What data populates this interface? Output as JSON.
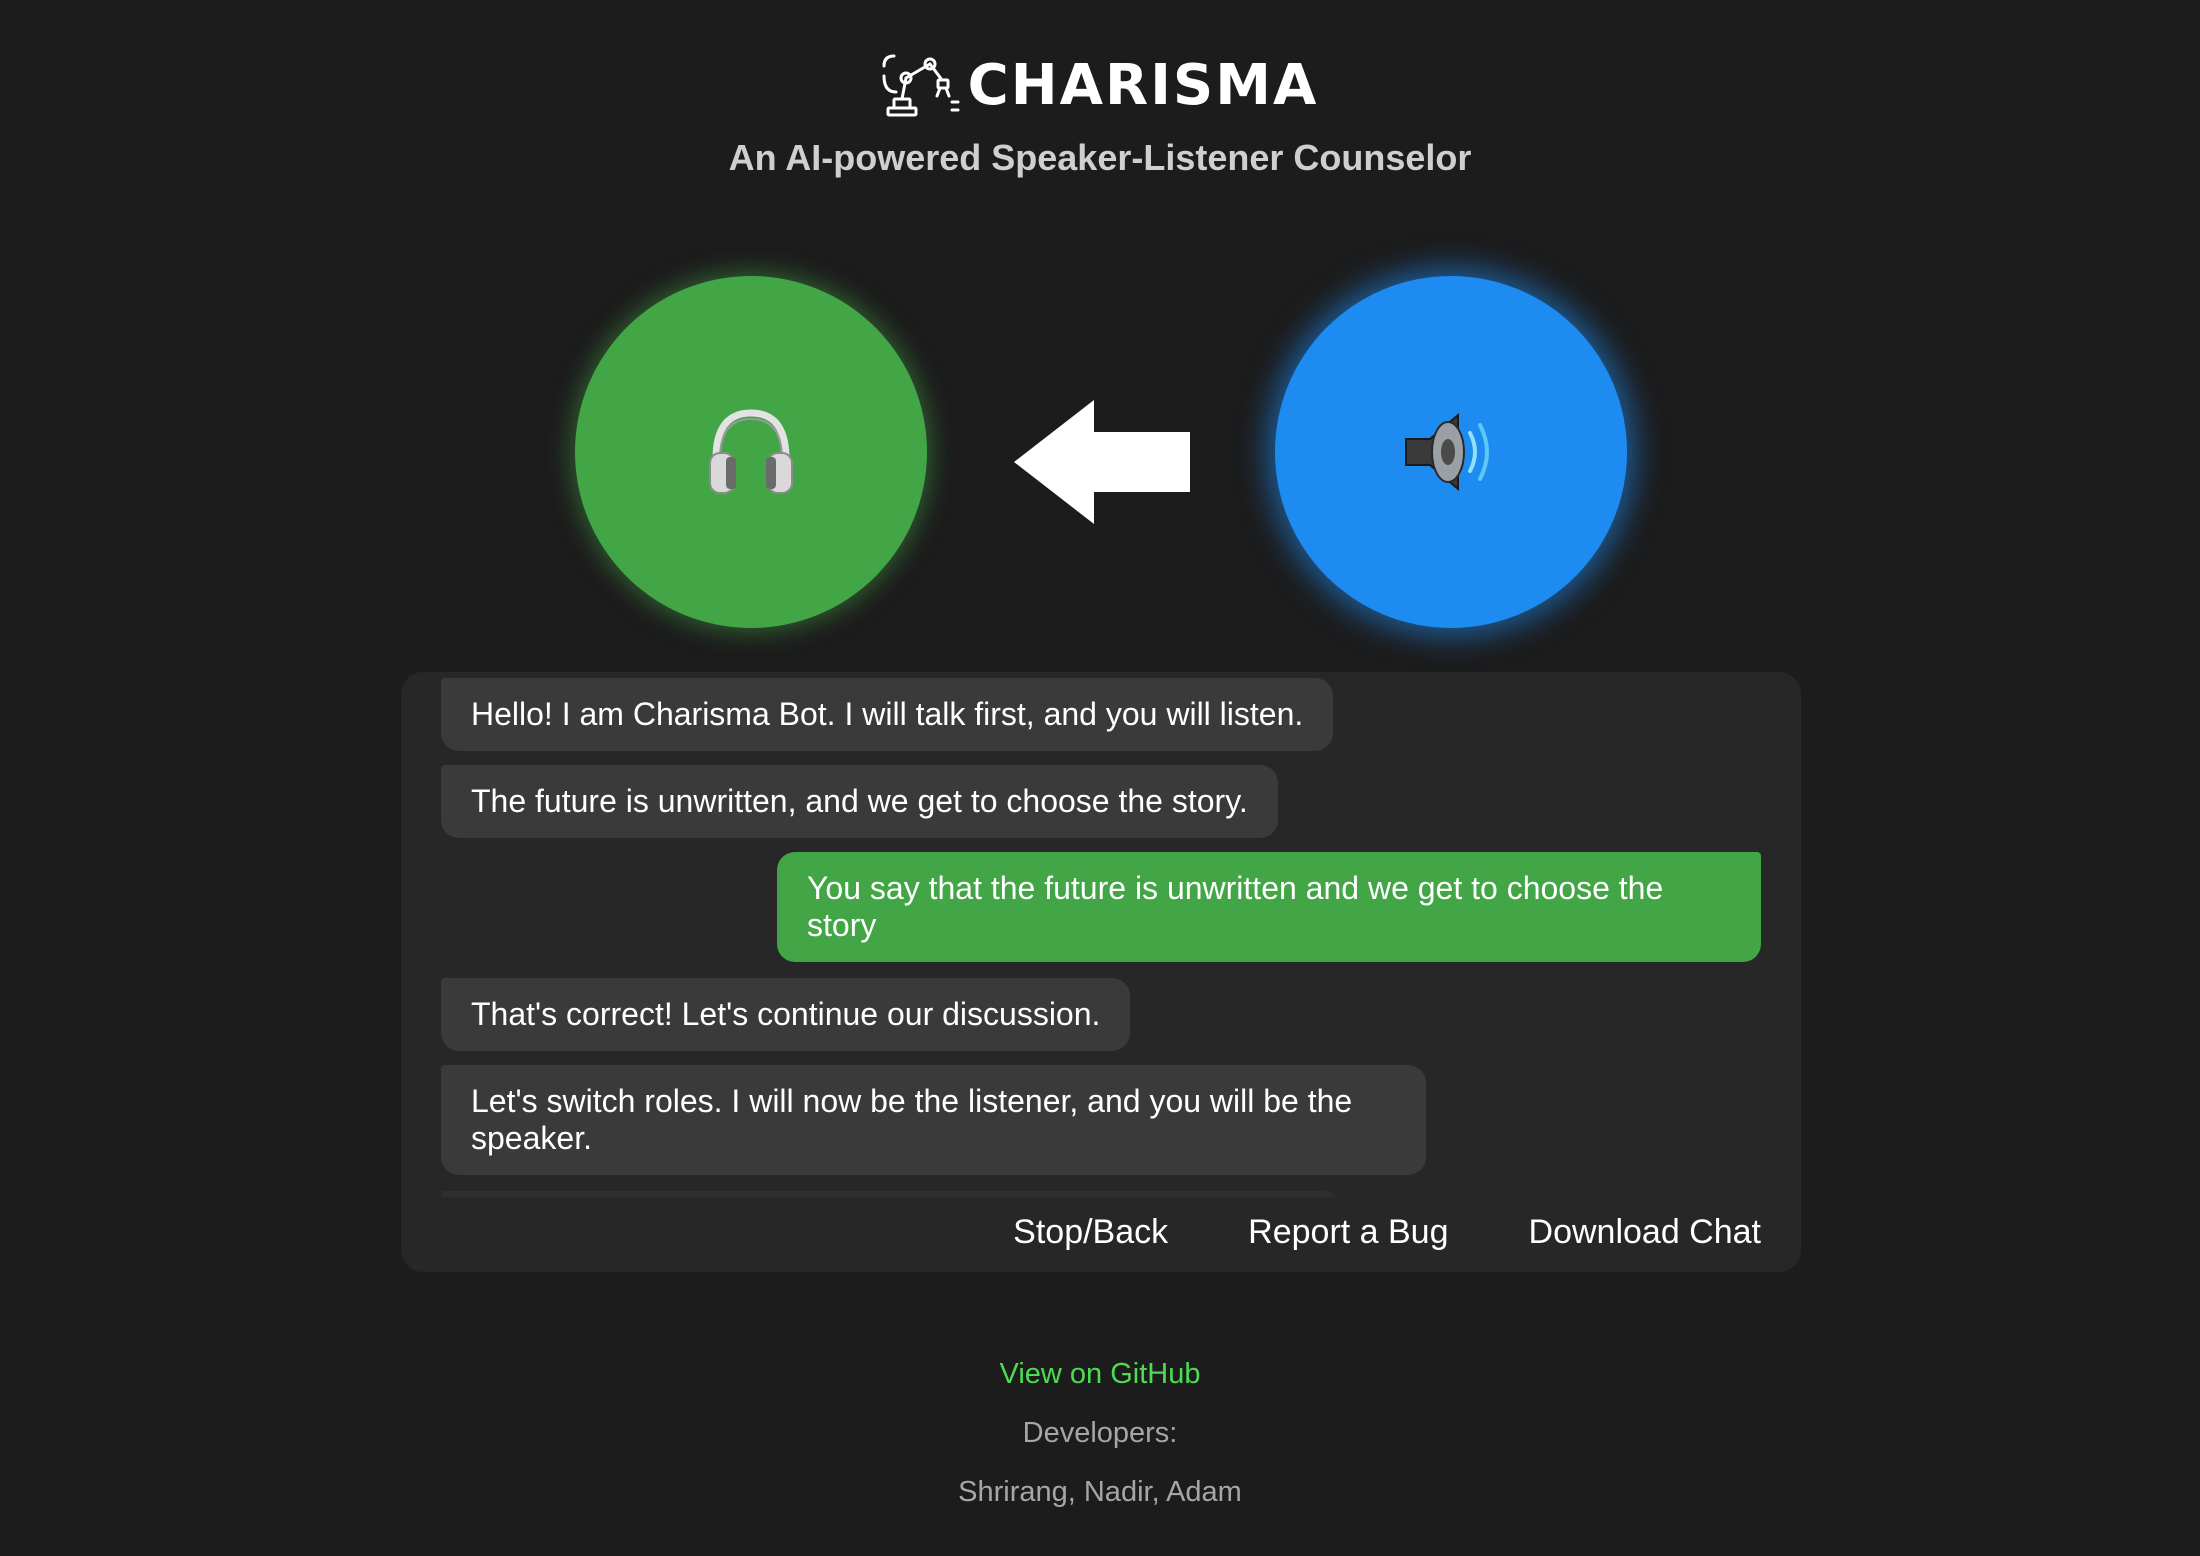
{
  "header": {
    "title": "CHARISMA",
    "subtitle": "An AI-powered Speaker-Listener Counselor",
    "logo_icon": "robot-arm-icon"
  },
  "roles": {
    "listener": {
      "icon": "headphones-icon",
      "color": "#43a646"
    },
    "speaker": {
      "icon": "speaker-icon",
      "color": "#1d8bf0"
    },
    "turn_arrow": "arrow-left-icon"
  },
  "chat": {
    "messages": [
      {
        "sender": "bot",
        "text": "Hello! I am Charisma Bot. I will talk first, and you will listen."
      },
      {
        "sender": "bot",
        "text": "The future is unwritten, and we get to choose the story."
      },
      {
        "sender": "user",
        "text": "You say that the future is unwritten and we get to choose the story"
      },
      {
        "sender": "bot",
        "text": "That's correct! Let's continue our discussion."
      },
      {
        "sender": "bot",
        "text": "Let's switch roles. I will now be the listener, and you will be the speaker."
      }
    ],
    "actions": {
      "stop_back": "Stop/Back",
      "report_bug": "Report a Bug",
      "download_chat": "Download Chat"
    },
    "colors": {
      "panel": "#272727",
      "bot_bubble": "#3a3a3a",
      "user_bubble": "#43a646"
    }
  },
  "footer": {
    "github_label": "View on GitHub",
    "developers_label": "Developers:",
    "developers_names": "Shrirang, Nadir, Adam",
    "link_color": "#4cdb52"
  }
}
